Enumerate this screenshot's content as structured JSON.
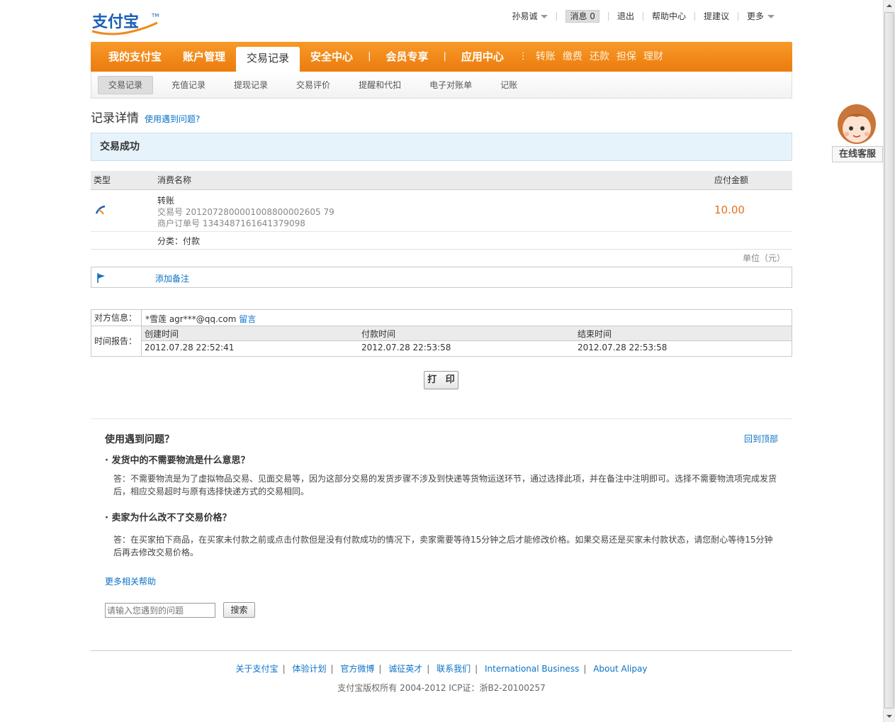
{
  "header": {
    "logo_text": "支付宝",
    "user": "孙易诚",
    "messages_label": "消息",
    "messages_count": "0",
    "logout": "退出",
    "help_center": "帮助中心",
    "suggestion": "提建议",
    "more": "更多"
  },
  "main_nav": {
    "tabs": [
      "我的支付宝",
      "账户管理",
      "交易记录",
      "安全中心",
      "会员专享",
      "应用中心"
    ],
    "active_index": 2,
    "quick_links": [
      "转账",
      "缴费",
      "还款",
      "担保",
      "理财"
    ]
  },
  "sub_nav": {
    "items": [
      "交易记录",
      "充值记录",
      "提现记录",
      "交易评价",
      "提醒和代扣",
      "电子对账单",
      "记账"
    ],
    "active_index": 0
  },
  "page": {
    "title": "记录详情",
    "help_link": "使用遇到问题?",
    "status": "交易成功"
  },
  "record": {
    "headers": {
      "type": "类型",
      "name": "消费名称",
      "amount": "应付金额"
    },
    "name": "转账",
    "trade_no": "交易号  2012072800001008800002605 79",
    "order_no": "商户订单号  1343487161641379098",
    "amount": "10.00",
    "category": "分类：付款",
    "unit": "单位（元）",
    "add_note": "添加备注"
  },
  "detail": {
    "party_label": "对方信息：",
    "party_name": "*雪莲  agr***@qq.com",
    "party_message": "留言",
    "time_label": "时间报告：",
    "time_headers": [
      "创建时间",
      "付款时间",
      "结束时间"
    ],
    "time_values": [
      "2012.07.28 22:52:41",
      "2012.07.28 22:53:58",
      "2012.07.28 22:53:58"
    ]
  },
  "print_label": "打 印",
  "help": {
    "title": "使用遇到问题？",
    "back_to_top": "回到顶部",
    "q1": "· 发货中的不需要物流是什么意思？",
    "a1_line1": "答：不需要物流是为了虚拟物品交易、见面交易等，因为这部分交易的发货步骤不涉及到快递等货物运送环节，通过选择此项，并在备注中注明即可。选择不需要物流项完成发货",
    "a1_line2": "后，相应交易超时与原有选择快递方式的交易相同。",
    "q2": "· 卖家为什么改不了交易价格？",
    "a2_line1": "答：在买家拍下商品，在买家未付款之前或点击付款但是没有付款成功的情况下，卖家需要等待15分钟之后才能修改价格。如果交易还是买家未付款状态，请您耐心等待15分钟",
    "a2_line2": "后再去修改交易价格。",
    "more_help": "更多相关帮助",
    "search_placeholder": "请输入您遇到的问题",
    "search_button": "搜索"
  },
  "footer": {
    "links": [
      "关于支付宝",
      "体验计划",
      "官方微博",
      "诚征英才",
      "联系我们",
      "International Business",
      "About Alipay"
    ],
    "copyright": "支付宝版权所有  2004-2012 ICP证：浙B2-20100257"
  },
  "service": {
    "label": "在线客服"
  },
  "colors": {
    "brand_orange": "#ec7b0d",
    "link_blue": "#0a72c8",
    "amount_orange": "#e8701a"
  }
}
